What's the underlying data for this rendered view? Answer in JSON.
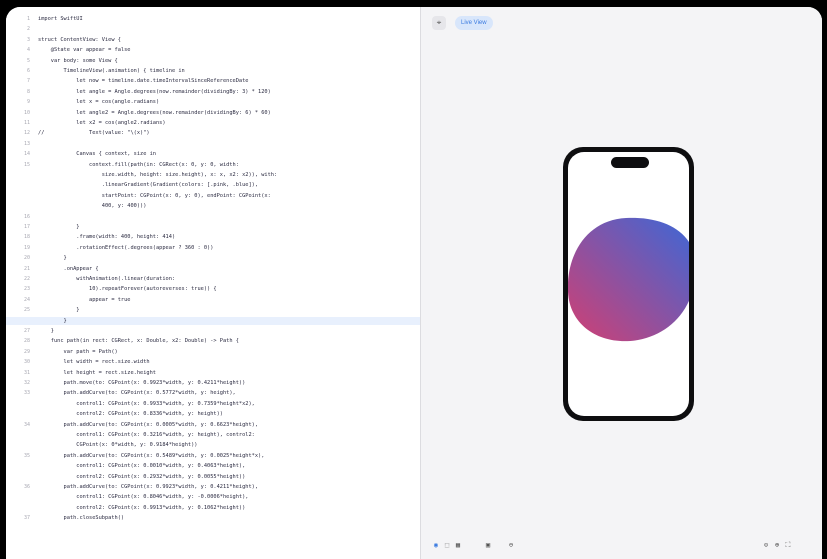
{
  "editor": {
    "lines": [
      {
        "num": "1",
        "text": "import SwiftUI"
      },
      {
        "num": "2",
        "text": ""
      },
      {
        "num": "3",
        "text": "struct ContentView: View {"
      },
      {
        "num": "4",
        "text": "    @State var appear = false"
      },
      {
        "num": "5",
        "text": "    var body: some View {"
      },
      {
        "num": "6",
        "text": "        TimelineView(.animation) { timeline in"
      },
      {
        "num": "7",
        "text": "            let now = timeline.date.timeIntervalSinceReferenceDate"
      },
      {
        "num": "8",
        "text": "            let angle = Angle.degrees(now.remainder(dividingBy: 3) * 120)"
      },
      {
        "num": "9",
        "text": "            let x = cos(angle.radians)"
      },
      {
        "num": "10",
        "text": "            let angle2 = Angle.degrees(now.remainder(dividingBy: 6) * 60)"
      },
      {
        "num": "11",
        "text": "            let x2 = cos(angle2.radians)"
      },
      {
        "num": "12",
        "text": "//              Text(value: \"\\(x)\")"
      },
      {
        "num": "13",
        "text": ""
      },
      {
        "num": "14",
        "text": "            Canvas { context, size in"
      },
      {
        "num": "15",
        "text": "                context.fill(path(in: CGRect(x: 0, y: 0, width:"
      },
      {
        "num": "",
        "text": "                    size.width, height: size.height), x: x, x2: x2)), with:"
      },
      {
        "num": "",
        "text": "                    .linearGradient(Gradient(colors: [.pink, .blue]),"
      },
      {
        "num": "",
        "text": "                    startPoint: CGPoint(x: 0, y: 0), endPoint: CGPoint(x:"
      },
      {
        "num": "",
        "text": "                    400, y: 400)))"
      },
      {
        "num": "16",
        "text": ""
      },
      {
        "num": "17",
        "text": "            }"
      },
      {
        "num": "18",
        "text": "            .frame(width: 400, height: 414)"
      },
      {
        "num": "19",
        "text": "            .rotationEffect(.degrees(appear ? 360 : 0))"
      },
      {
        "num": "20",
        "text": "        }"
      },
      {
        "num": "21",
        "text": "        .onAppear {"
      },
      {
        "num": "22",
        "text": "            withAnimation(.linear(duration:"
      },
      {
        "num": "23",
        "text": "                10).repeatForever(autoreverses: true)) {"
      },
      {
        "num": "24",
        "text": "                appear = true"
      },
      {
        "num": "25",
        "text": "            }"
      },
      {
        "num": "26",
        "text": "        }"
      },
      {
        "num": "27",
        "text": "    }"
      },
      {
        "num": "28",
        "text": "    func path(in rect: CGRect, x: Double, x2: Double) -> Path {"
      },
      {
        "num": "29",
        "text": "        var path = Path()"
      },
      {
        "num": "30",
        "text": "        let width = rect.size.width"
      },
      {
        "num": "31",
        "text": "        let height = rect.size.height"
      },
      {
        "num": "32",
        "text": "        path.move(to: CGPoint(x: 0.9923*width, y: 0.4211*height))"
      },
      {
        "num": "33",
        "text": "        path.addCurve(to: CGPoint(x: 0.5772*width, y: height),"
      },
      {
        "num": "",
        "text": "            control1: CGPoint(x: 0.9933*width, y: 0.7359*height*x2),"
      },
      {
        "num": "",
        "text": "            control2: CGPoint(x: 0.8336*width, y: height))"
      },
      {
        "num": "34",
        "text": "        path.addCurve(to: CGPoint(x: 0.0005*width, y: 0.6623*height),"
      },
      {
        "num": "",
        "text": "            control1: CGPoint(x: 0.3216*width, y: height), control2:"
      },
      {
        "num": "",
        "text": "            CGPoint(x: 0*width, y: 0.9184*height))"
      },
      {
        "num": "35",
        "text": "        path.addCurve(to: CGPoint(x: 0.5489*width, y: 0.0025*height*x),"
      },
      {
        "num": "",
        "text": "            control1: CGPoint(x: 0.0010*width, y: 0.4063*height),"
      },
      {
        "num": "",
        "text": "            control2: CGPoint(x: 0.2932*width, y: 0.0055*height))"
      },
      {
        "num": "36",
        "text": "        path.addCurve(to: CGPoint(x: 0.9923*width, y: 0.4211*height),"
      },
      {
        "num": "",
        "text": "            control1: CGPoint(x: 0.8046*width, y: -0.0006*height),"
      },
      {
        "num": "",
        "text": "            control2: CGPoint(x: 0.9913*width, y: 0.1062*height))"
      },
      {
        "num": "37",
        "text": "        path.closeSubpath()"
      }
    ]
  },
  "preview": {
    "pin_icon": "pin-icon",
    "live_label": "Live View",
    "blob_gradient": {
      "start": "#d23f72",
      "end": "#3a68d8"
    },
    "bottom_bar": [
      {
        "name": "live-mode-icon",
        "glyph": "◉"
      },
      {
        "name": "selectable-icon",
        "glyph": "⬚"
      },
      {
        "name": "variants-icon",
        "glyph": "▦"
      },
      {
        "name": "device-settings-icon",
        "glyph": "▣"
      },
      {
        "name": "zoom-out-icon",
        "glyph": "⊖"
      },
      {
        "name": "zoom-actual-icon",
        "glyph": "⊙"
      },
      {
        "name": "zoom-in-icon",
        "glyph": "⊕"
      },
      {
        "name": "zoom-fit-icon",
        "glyph": "⛶"
      }
    ]
  }
}
